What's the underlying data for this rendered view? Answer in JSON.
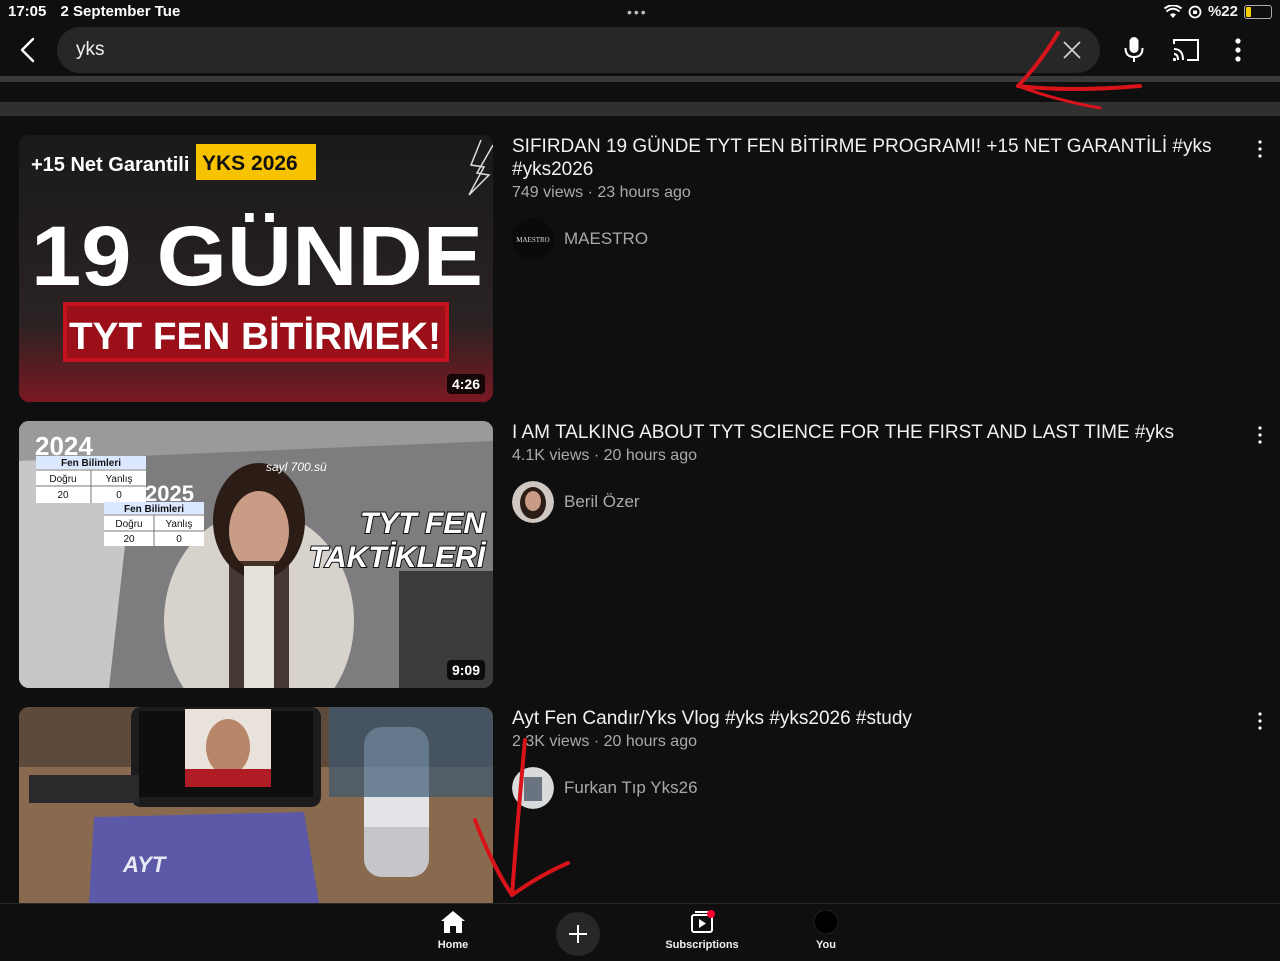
{
  "status_bar": {
    "time": "17:05",
    "date": "2 September Tue",
    "battery": "%22"
  },
  "search": {
    "query": "yks"
  },
  "icons": {
    "back": "chevron-left-icon",
    "clear": "close-icon",
    "mic": "microphone-icon",
    "cast": "cast-icon",
    "more": "more-vertical-icon",
    "home": "home-icon",
    "create": "plus-icon",
    "subscriptions": "subscriptions-icon"
  },
  "results": [
    {
      "title": "SIFIRDAN 19 GÜNDE TYT FEN BİTİRME PROGRAMI! +15 NET GARANTİLİ #yks #yks2026",
      "meta": "749 views · 23 hours ago",
      "channel": "MAESTRO",
      "duration": "4:26",
      "avatar_text": "MAESTRO",
      "thumb_text": {
        "tag": "+15 Net Garantili",
        "badge": "YKS 2026",
        "big": "19 GÜNDE",
        "banner": "TYT FEN BİTİRMEK!"
      }
    },
    {
      "title": "I AM TALKING ABOUT TYT SCIENCE FOR THE FIRST AND LAST TIME #yks",
      "meta": "4.1K views · 20 hours ago",
      "channel": "Beril Özer",
      "duration": "9:09",
      "thumb_text": {
        "year1": "2024",
        "year2": "2025",
        "table_title": "Fen Bilimleri",
        "col1": "Doğru",
        "col2": "Yanlış",
        "val1": "20",
        "val2": "0",
        "rank": "sayl 700.sü",
        "line1": "TYT FEN",
        "line2": "TAKTİKLERİ"
      }
    },
    {
      "title": "Ayt Fen Candır/Yks Vlog #yks #yks2026 #study",
      "meta": "2.3K views · 20 hours ago",
      "channel": "Furkan Tıp Yks26",
      "thumb_text": {
        "notebook": "AYT"
      }
    }
  ],
  "bottom_nav": {
    "home": "Home",
    "subscriptions": "Subscriptions",
    "you": "You"
  }
}
